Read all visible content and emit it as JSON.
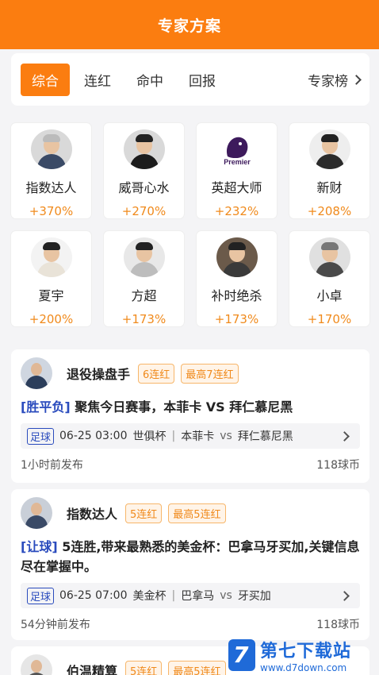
{
  "header": {
    "title": "专家方案"
  },
  "tabs": [
    {
      "label": "综合",
      "active": true
    },
    {
      "label": "连红",
      "active": false
    },
    {
      "label": "命中",
      "active": false
    },
    {
      "label": "回报",
      "active": false
    }
  ],
  "rank_link": "专家榜",
  "experts": [
    {
      "name": "指数达人",
      "rate": "+370%",
      "shirt": "#3a4a66"
    },
    {
      "name": "威哥心水",
      "rate": "+270%",
      "shirt": "#1c1c1c"
    },
    {
      "name": "英超大师",
      "rate": "+232%",
      "shirt": "#3d1a5c"
    },
    {
      "name": "新财",
      "rate": "+208%",
      "shirt": "#2b2b2b"
    },
    {
      "name": "夏宇",
      "rate": "+200%",
      "shirt": "#e9e3d8"
    },
    {
      "name": "方超",
      "rate": "+173%",
      "shirt": "#d4d4d4"
    },
    {
      "name": "补时绝杀",
      "rate": "+173%",
      "shirt": "#3a3a3a"
    },
    {
      "name": "小卓",
      "rate": "+170%",
      "shirt": "#4a4a4a"
    }
  ],
  "posts": [
    {
      "author": "退役操盘手",
      "streak": "6连红",
      "best": "最高7连红",
      "tag": "[胜平负]",
      "text": " 聚焦今日赛事，本菲卡 VS 拜仁慕尼黑",
      "sport": "足球",
      "time": "06-25 03:00",
      "league": "世俱杯",
      "home": "本菲卡",
      "vs": "vs",
      "away": "拜仁慕尼黑",
      "posted": "1小时前发布",
      "price": "118球币"
    },
    {
      "author": "指数达人",
      "streak": "5连红",
      "best": "最高5连红",
      "tag": "[让球]",
      "text": " 5连胜,带来最熟悉的美金杯：巴拿马牙买加,关键信息尽在掌握中。",
      "sport": "足球",
      "time": "06-25 07:00",
      "league": "美金杯",
      "home": "巴拿马",
      "vs": "vs",
      "away": "牙买加",
      "posted": "54分钟前发布",
      "price": "118球币"
    },
    {
      "author": "伯温精算",
      "streak": "5连红",
      "best": "最高5连红"
    }
  ],
  "watermark": {
    "name": "第七下载站",
    "url": "www.d7down.com"
  }
}
